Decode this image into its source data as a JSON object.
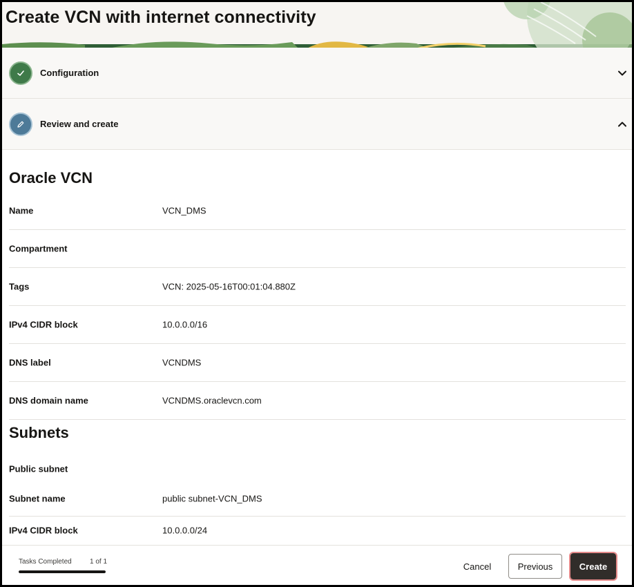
{
  "header": {
    "title": "Create VCN with internet connectivity"
  },
  "steps": [
    {
      "label": "Configuration",
      "state": "completed",
      "icon": "check-icon",
      "expanded": false
    },
    {
      "label": "Review and create",
      "state": "current",
      "icon": "pencil-icon",
      "expanded": true
    }
  ],
  "vcn": {
    "title": "Oracle VCN",
    "rows": [
      {
        "label": "Name",
        "value": "VCN_DMS"
      },
      {
        "label": "Compartment",
        "value": ""
      },
      {
        "label": "Tags",
        "value": "VCN: 2025-05-16T00:01:04.880Z"
      },
      {
        "label": "IPv4 CIDR block",
        "value": "10.0.0.0/16"
      },
      {
        "label": "DNS label",
        "value": "VCNDMS"
      },
      {
        "label": "DNS domain name",
        "value": "VCNDMS.oraclevcn.com"
      }
    ]
  },
  "subnets": {
    "title": "Subnets",
    "public_subnet_heading": "Public subnet",
    "rows": [
      {
        "label": "Subnet name",
        "value": "public subnet-VCN_DMS"
      },
      {
        "label": "IPv4 CIDR block",
        "value": "10.0.0.0/24"
      }
    ]
  },
  "footer": {
    "tasks_label": "Tasks Completed",
    "tasks_count": "1 of 1",
    "progress_fraction": 1.0,
    "cancel_label": "Cancel",
    "previous_label": "Previous",
    "create_label": "Create"
  },
  "colors": {
    "completed_step": "#3f7a49",
    "current_step": "#4d7a98",
    "primary_button": "#312d2a",
    "focus_outline": "#e58a8a"
  }
}
